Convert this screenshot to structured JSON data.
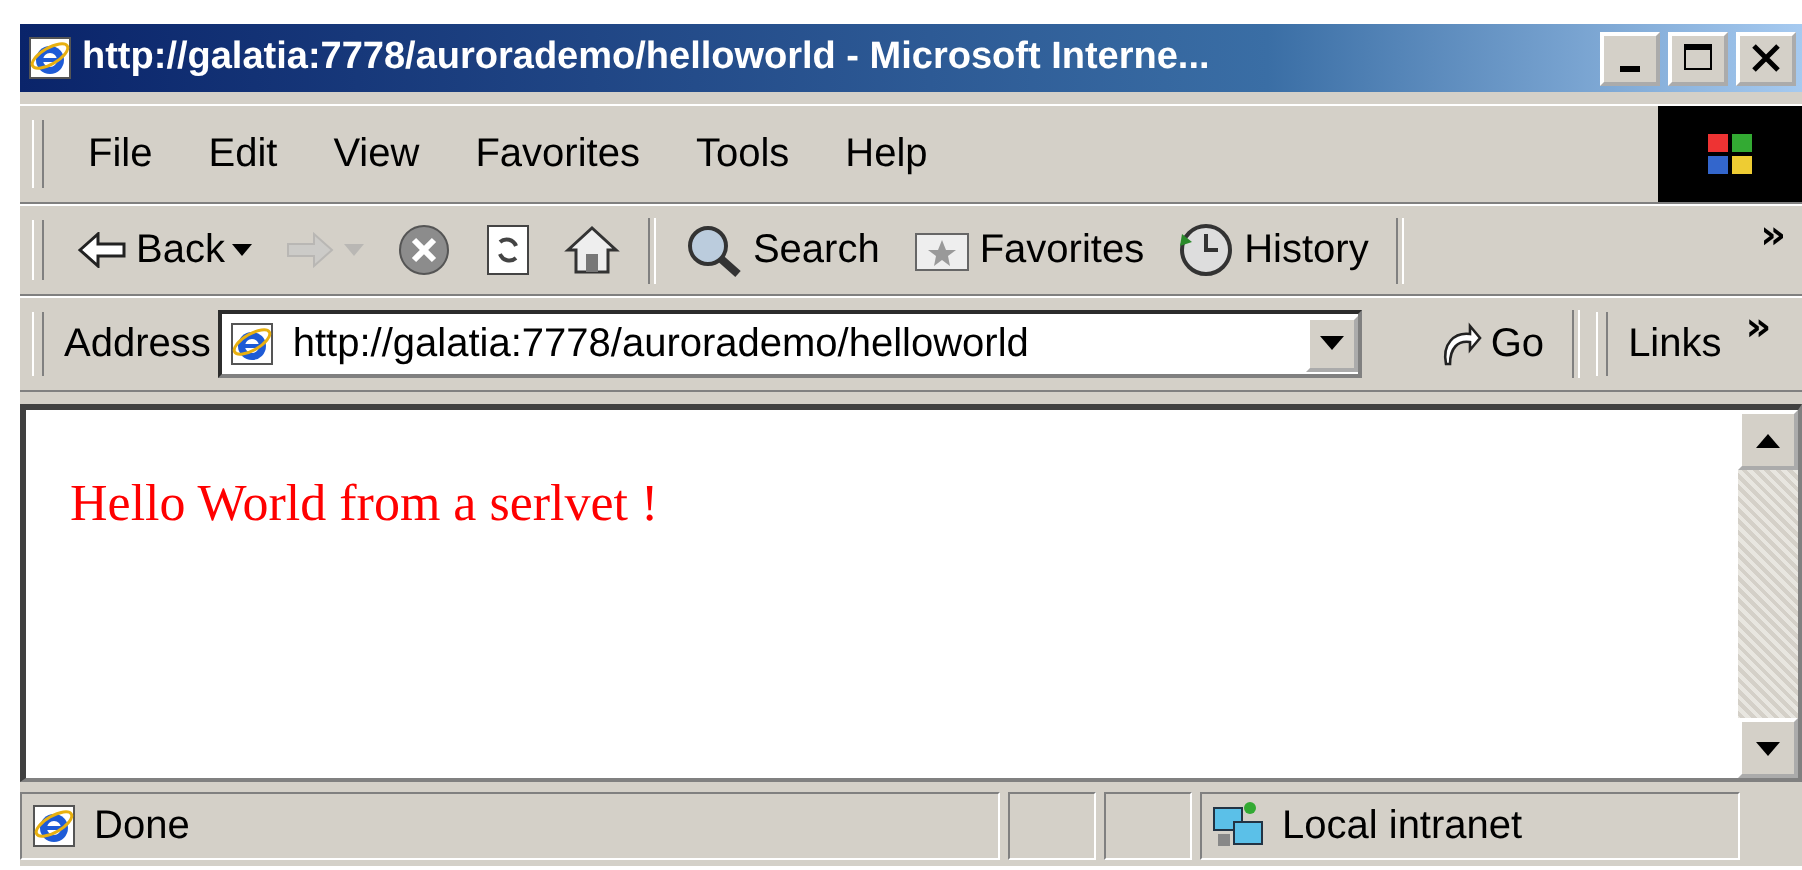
{
  "window": {
    "title": "http://galatia:7778/aurorademo/helloworld - Microsoft Interne..."
  },
  "menu": [
    "File",
    "Edit",
    "View",
    "Favorites",
    "Tools",
    "Help"
  ],
  "toolbar": {
    "buttons": [
      {
        "kind": "back",
        "label": "Back",
        "disabled": false,
        "dropdown": true
      },
      {
        "kind": "forward",
        "disabled": true,
        "dropdown": true
      },
      {
        "kind": "stop",
        "disabled": false,
        "dropdown": false
      },
      {
        "kind": "refresh",
        "disabled": false,
        "dropdown": false
      },
      {
        "kind": "home",
        "disabled": false,
        "dropdown": false
      },
      {
        "kind": "search",
        "label": "Search",
        "disabled": false,
        "dropdown": false
      },
      {
        "kind": "favorites",
        "label": "Favorites",
        "disabled": false,
        "dropdown": false
      },
      {
        "kind": "history",
        "label": "History",
        "disabled": false,
        "dropdown": false
      }
    ],
    "more": "»"
  },
  "address": {
    "label": "Address",
    "value": "http://galatia:7778/aurorademo/helloworld",
    "go": "Go",
    "links": "Links",
    "links_more": "»"
  },
  "page": {
    "text": "Hello World from a serlvet !"
  },
  "status_bar": {
    "text": "Done",
    "zone": "Local intranet"
  }
}
